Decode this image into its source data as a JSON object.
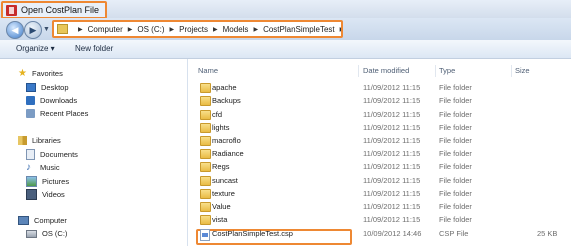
{
  "window": {
    "title": "Open CostPlan File"
  },
  "address": {
    "crumbs": [
      "Computer",
      "OS (C:)",
      "Projects",
      "Models",
      "CostPlanSimpleTest"
    ]
  },
  "toolbar": {
    "organize": "Organize ▾",
    "new_folder": "New folder"
  },
  "sidebar": {
    "favorites": "Favorites",
    "fav_items": [
      "Desktop",
      "Downloads",
      "Recent Places"
    ],
    "libraries": "Libraries",
    "lib_items": [
      "Documents",
      "Music",
      "Pictures",
      "Videos"
    ],
    "computer": "Computer",
    "drive": "OS (C:)"
  },
  "columns": {
    "name": "Name",
    "date": "Date modified",
    "type": "Type",
    "size": "Size"
  },
  "files": [
    {
      "name": "apache",
      "date": "11/09/2012 11:15",
      "type": "File folder",
      "size": "",
      "kind": "folder"
    },
    {
      "name": "Backups",
      "date": "11/09/2012 11:15",
      "type": "File folder",
      "size": "",
      "kind": "folder"
    },
    {
      "name": "cfd",
      "date": "11/09/2012 11:15",
      "type": "File folder",
      "size": "",
      "kind": "folder"
    },
    {
      "name": "lights",
      "date": "11/09/2012 11:15",
      "type": "File folder",
      "size": "",
      "kind": "folder"
    },
    {
      "name": "macroflo",
      "date": "11/09/2012 11:15",
      "type": "File folder",
      "size": "",
      "kind": "folder"
    },
    {
      "name": "Radiance",
      "date": "11/09/2012 11:15",
      "type": "File folder",
      "size": "",
      "kind": "folder"
    },
    {
      "name": "Regs",
      "date": "11/09/2012 11:15",
      "type": "File folder",
      "size": "",
      "kind": "folder"
    },
    {
      "name": "suncast",
      "date": "11/09/2012 11:15",
      "type": "File folder",
      "size": "",
      "kind": "folder"
    },
    {
      "name": "texture",
      "date": "11/09/2012 11:15",
      "type": "File folder",
      "size": "",
      "kind": "folder"
    },
    {
      "name": "Value",
      "date": "11/09/2012 11:15",
      "type": "File folder",
      "size": "",
      "kind": "folder"
    },
    {
      "name": "vista",
      "date": "11/09/2012 11:15",
      "type": "File folder",
      "size": "",
      "kind": "folder"
    },
    {
      "name": "CostPlanSimpleTest.csp",
      "date": "10/09/2012 14:46",
      "type": "CSP File",
      "size": "25 KB",
      "kind": "file"
    }
  ]
}
